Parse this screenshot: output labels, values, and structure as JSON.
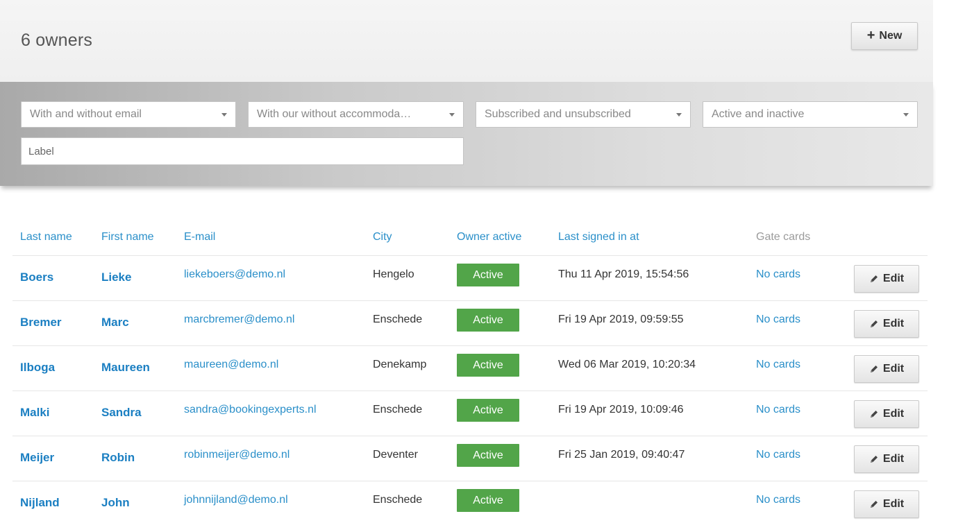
{
  "header": {
    "title": "6 owners",
    "new_label": "New"
  },
  "filters": {
    "email": "With and without email",
    "accommodation": "With our without accommoda…",
    "subscription": "Subscribed and unsubscribed",
    "activity": "Active and inactive",
    "label_placeholder": "Label"
  },
  "table": {
    "columns": {
      "last_name": "Last name",
      "first_name": "First name",
      "email": "E-mail",
      "city": "City",
      "owner_active": "Owner active",
      "last_signed_in": "Last signed in at",
      "gate_cards": "Gate cards"
    },
    "rows": [
      {
        "last": "Boers",
        "first": "Lieke",
        "email": "liekeboers@demo.nl",
        "city": "Hengelo",
        "status": "Active",
        "signed": "Thu 11 Apr 2019, 15:54:56",
        "cards": "No cards",
        "edit": "Edit"
      },
      {
        "last": "Bremer",
        "first": "Marc",
        "email": "marcbremer@demo.nl",
        "city": "Enschede",
        "status": "Active",
        "signed": "Fri 19 Apr 2019, 09:59:55",
        "cards": "No cards",
        "edit": "Edit"
      },
      {
        "last": "Ilboga",
        "first": "Maureen",
        "email": "maureen@demo.nl",
        "city": "Denekamp",
        "status": "Active",
        "signed": "Wed 06 Mar 2019, 10:20:34",
        "cards": "No cards",
        "edit": "Edit"
      },
      {
        "last": "Malki",
        "first": "Sandra",
        "email": "sandra@bookingexperts.nl",
        "city": "Enschede",
        "status": "Active",
        "signed": "Fri 19 Apr 2019, 10:09:46",
        "cards": "No cards",
        "edit": "Edit"
      },
      {
        "last": "Meijer",
        "first": "Robin",
        "email": "robinmeijer@demo.nl",
        "city": "Deventer",
        "status": "Active",
        "signed": "Fri 25 Jan 2019, 09:40:47",
        "cards": "No cards",
        "edit": "Edit"
      },
      {
        "last": "Nijland",
        "first": "John",
        "email": "johnnijland@demo.nl",
        "city": "Enschede",
        "status": "Active",
        "signed": "",
        "cards": "No cards",
        "edit": "Edit"
      }
    ]
  },
  "colors": {
    "link": "#2a8fc9",
    "active_badge": "#52a549"
  }
}
